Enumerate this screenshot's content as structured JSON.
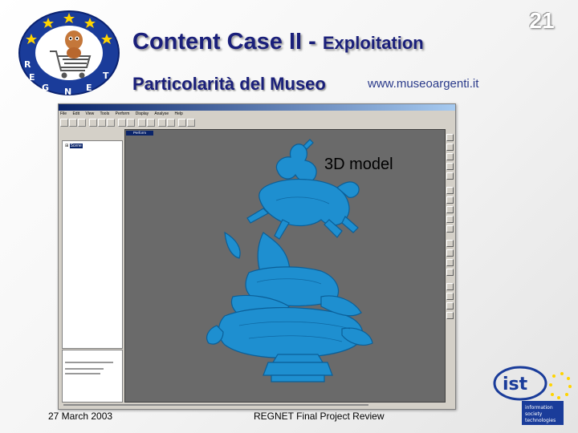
{
  "slide": {
    "number": "21",
    "title_main": "Content Case II - ",
    "title_small": "Exploitation",
    "subtitle": "Particolarità del Museo",
    "url": "www.museoargenti.it",
    "model_label": "3D model",
    "footer_date": "27 March 2003",
    "footer_center": "REGNET Final Project Review"
  },
  "logos": {
    "regnet": "REGNET",
    "ist_main": "ist",
    "ist_lines": [
      "information",
      "society",
      "technologies"
    ]
  },
  "app": {
    "menu": [
      "File",
      "Edit",
      "View",
      "Tools",
      "Perform",
      "Display",
      "Analyse",
      "Help"
    ],
    "tree_item": "Scene",
    "viewport_tab": "Perform"
  },
  "colors": {
    "title": "#1a1f7a",
    "model": "#1e8fd0",
    "viewport": "#6a6a6a",
    "window_title": "#0a246a"
  }
}
